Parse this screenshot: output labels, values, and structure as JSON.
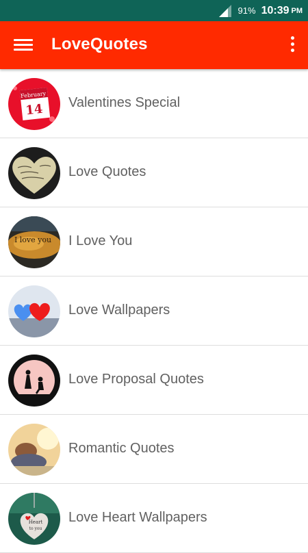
{
  "status_bar": {
    "battery_percent": "91%",
    "time": "10:39",
    "ampm": "PM",
    "icons": [
      "signal-icon"
    ]
  },
  "app_bar": {
    "title": "LoveQuotes",
    "background_color": "#ff2a00",
    "icons": [
      "menu-icon",
      "overflow-menu-icon"
    ]
  },
  "categories": [
    {
      "label": "Valentines Special",
      "icon": "calendar-february-14-icon",
      "thumb_text_1": "February",
      "thumb_text_2": "14"
    },
    {
      "label": "Love Quotes",
      "icon": "heart-note-icon"
    },
    {
      "label": "I Love You",
      "icon": "i-love-you-leaf-icon",
      "thumb_text": "I love you"
    },
    {
      "label": "Love Wallpapers",
      "icon": "hearts-wallpaper-icon"
    },
    {
      "label": "Love Proposal Quotes",
      "icon": "proposal-silhouette-icon"
    },
    {
      "label": "Romantic Quotes",
      "icon": "romantic-couple-icon"
    },
    {
      "label": "Love Heart Wallpapers",
      "icon": "heart-pendant-icon",
      "thumb_text_1": "Heart",
      "thumb_text_2": "to you"
    }
  ],
  "colors": {
    "status_bar": "#0f6457",
    "app_bar": "#ff2a00",
    "list_text": "#616161",
    "divider": "#dddddd"
  }
}
